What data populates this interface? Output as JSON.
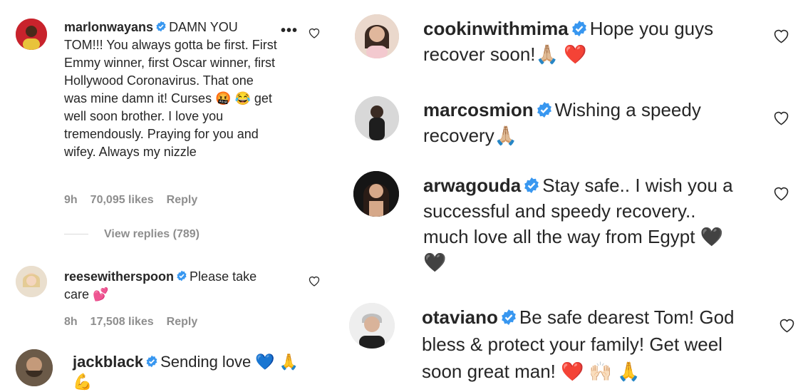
{
  "comments_left": [
    {
      "username": "marlonwayans",
      "text": "DAMN YOU TOM!!! You always gotta be first. First Emmy winner, first Oscar winner, first Hollywood Coronavirus. That one was mine damn it! Curses 🤬 😂 get well soon brother. I love you tremendously. Praying for you and wifey. Always my nizzle",
      "time": "9h",
      "likes": "70,095 likes",
      "reply": "Reply",
      "view_replies": "View replies (789)"
    },
    {
      "username": "reesewitherspoon",
      "text": "Please take care 💕",
      "time": "8h",
      "likes": "17,508 likes",
      "reply": "Reply"
    },
    {
      "username": "jackblack",
      "text": "Sending love 💙 🙏 💪"
    }
  ],
  "comments_right": [
    {
      "username": "cookinwithmima",
      "text": "Hope you guys recover soon!🙏🏼 ❤️"
    },
    {
      "username": "marcosmion",
      "text": "Wishing a speedy recovery🙏🏼"
    },
    {
      "username": "arwagouda",
      "text": "Stay safe.. I wish you a successful and speedy recovery.. much love all the way from Egypt 🖤🖤"
    },
    {
      "username": "otaviano",
      "text": "Be safe dearest Tom! God bless & protect your family! Get weel soon great man! ❤️ 🙌🏻 🙏"
    }
  ],
  "colors": {
    "verified": "#3897f0",
    "muted": "#8e8e8e",
    "text": "#262626"
  },
  "icons": {
    "verified": "verified-badge-icon",
    "like": "heart-outline-icon",
    "more": "more-options-icon"
  }
}
